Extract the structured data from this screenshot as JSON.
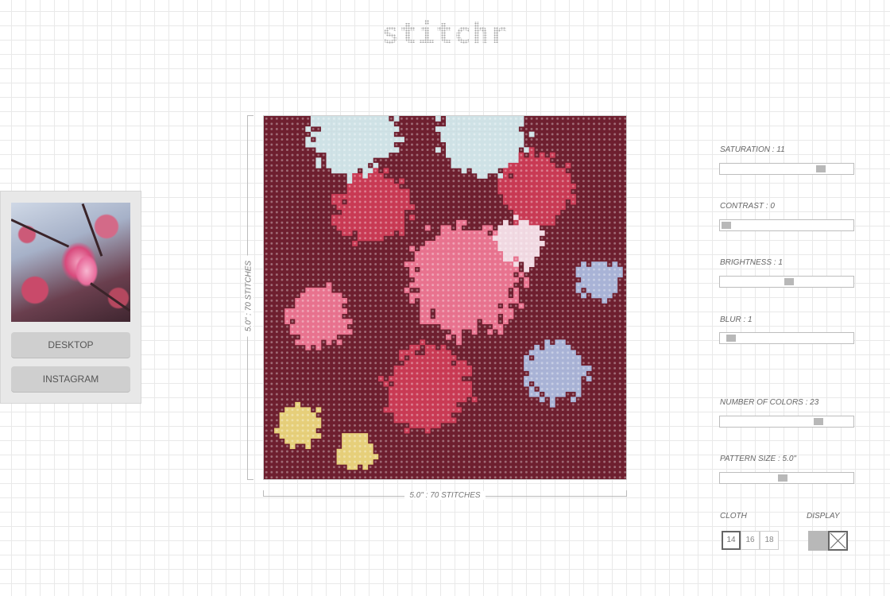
{
  "app": {
    "logo": "stitchr"
  },
  "sidebar": {
    "buttons": [
      {
        "label": "DESKTOP"
      },
      {
        "label": "INSTAGRAM"
      }
    ]
  },
  "pattern": {
    "width_label": "5.0\" : 70 STITCHES",
    "height_label": "5.0\" : 70 STITCHES",
    "stitches": 70
  },
  "controls": {
    "saturation": {
      "label": "SATURATION : 11",
      "position": 0.78
    },
    "contrast": {
      "label": "CONTRAST : 0",
      "position": 0.0
    },
    "brightness": {
      "label": "BRIGHTNESS : 1",
      "position": 0.52
    },
    "blur": {
      "label": "BLUR : 1",
      "position": 0.04
    },
    "number_of_colors": {
      "label": "NUMBER OF COLORS : 23",
      "position": 0.76
    },
    "pattern_size": {
      "label": "PATTERN SIZE : 5.0\"",
      "position": 0.47
    },
    "cloth": {
      "label": "CLOTH",
      "options": [
        "14",
        "16",
        "18"
      ],
      "selected": "14"
    },
    "display": {
      "label": "DISPLAY",
      "selected": "cross"
    }
  },
  "colors": {
    "background": "#ffffff",
    "grid": "#e9e9e9",
    "button": "#cfcfcf",
    "knob": "#b8b8b8",
    "stitch_dark": "#6e1f2f",
    "stitch_pink": "#e8738f",
    "stitch_red": "#c93a54",
    "stitch_light": "#f1d9e2",
    "stitch_blue": "#a9b3d6",
    "stitch_sky": "#cfe2e6",
    "stitch_yellow": "#e6cf7a"
  }
}
